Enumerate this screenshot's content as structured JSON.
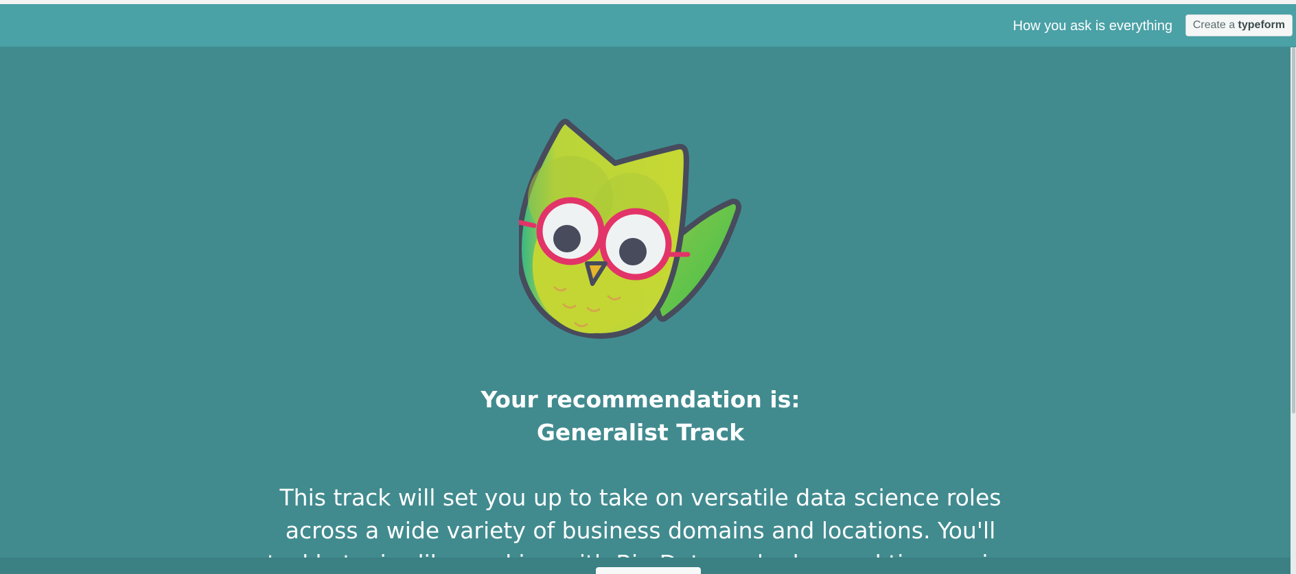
{
  "header": {
    "tagline": "How you ask is everything",
    "create_prefix": "Create a",
    "create_brand": "typeform"
  },
  "result": {
    "title_line1": "Your recommendation is:",
    "title_line2": "Generalist Track",
    "description": "This track will set you up to take on versatile data science roles across a wide variety of business domains and locations. You'll tackle topics like working with Big Data and advanced time series"
  },
  "icons": {
    "mascot": "owl-mascot-icon"
  },
  "colors": {
    "header_bg": "#4aa1a6",
    "content_bg": "#418b8f",
    "owl_body": "#c3d737",
    "owl_wing": "#3fbf4a",
    "glasses": "#e23468",
    "outline": "#474b5c"
  }
}
